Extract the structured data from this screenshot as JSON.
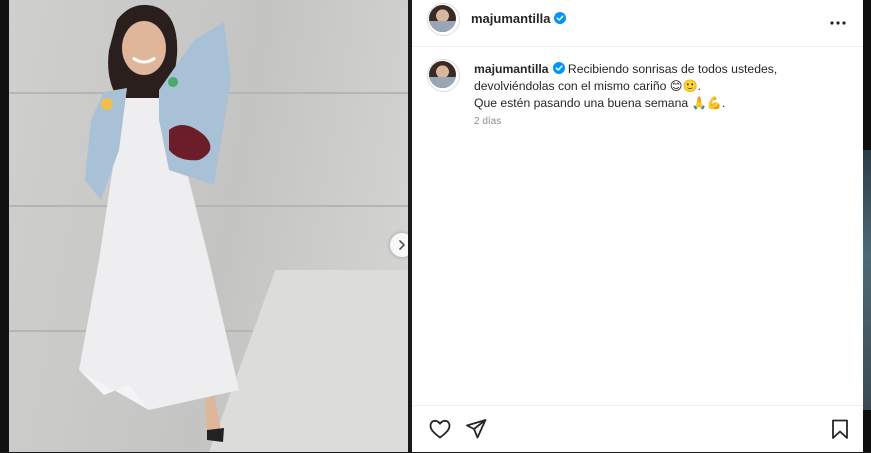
{
  "post": {
    "username": "majumantilla",
    "caption": {
      "username": "majumantilla",
      "line1": "Recibiendo sonrisas de todos ustedes,",
      "line2_text": "devolviéndolas con el mismo cariño ",
      "line2_emoji": "😊🙂",
      "line2_end": ".",
      "line3_text": "Que estén pasando una buena semana ",
      "line3_emoji": "🙏💪",
      "line3_end": "."
    },
    "timestamp": "2 días"
  },
  "icons": {
    "verified": "verified-badge-icon",
    "more": "more-options-icon",
    "next": "chevron-right-icon",
    "like": "heart-icon",
    "share": "send-icon",
    "save": "bookmark-icon"
  },
  "colors": {
    "verified": "#0095f6",
    "text": "#262626",
    "muted": "#8e8e8e"
  }
}
